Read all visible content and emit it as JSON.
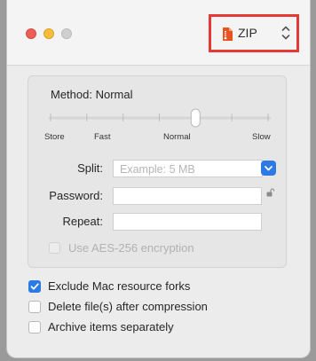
{
  "format": {
    "label": "ZIP",
    "icon": "zip-file-icon"
  },
  "method": {
    "label": "Method: Normal",
    "levels": [
      "Store",
      "Fast",
      "Normal",
      "Slow"
    ],
    "selected_index": 4,
    "selected_level": "Normal",
    "tick_count": 7
  },
  "split": {
    "label": "Split:",
    "placeholder": "Example: 5 MB"
  },
  "password": {
    "label": "Password:",
    "value": ""
  },
  "repeat": {
    "label": "Repeat:",
    "value": ""
  },
  "aes": {
    "label": "Use AES-256 encryption",
    "checked": false,
    "enabled": false
  },
  "options": [
    {
      "label": "Exclude Mac resource forks",
      "checked": true
    },
    {
      "label": "Delete file(s) after compression",
      "checked": false
    },
    {
      "label": "Archive items separately",
      "checked": false
    }
  ],
  "colors": {
    "accent": "#2b7be5",
    "highlight": "#e53935"
  }
}
